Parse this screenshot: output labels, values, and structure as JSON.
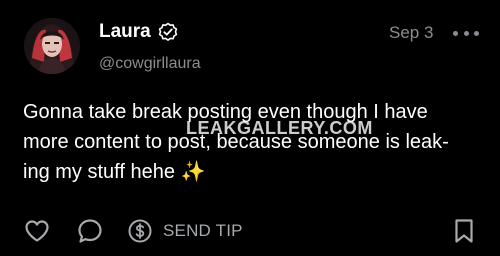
{
  "post": {
    "author": {
      "display_name": "Laura",
      "handle": "@cowgirllaura",
      "verified": true
    },
    "date": "Sep 3",
    "body_lines": [
      "Gonna take break posting even though I have",
      "more content to post, because someone is leak-",
      "ing my stuff hehe ✨"
    ],
    "watermark": "LEAKGALLERY.COM",
    "actions": {
      "send_tip_label": "SEND TIP"
    },
    "icons": {
      "verified": "verified-badge-icon",
      "more": "more-options-icon",
      "like": "heart-icon",
      "comment": "comment-bubble-icon",
      "tip": "dollar-coin-icon",
      "bookmark": "bookmark-icon"
    }
  },
  "colors": {
    "background": "#000000",
    "text_primary": "#ffffff",
    "text_secondary": "#8a8d91",
    "icon": "#a6a9ad"
  }
}
